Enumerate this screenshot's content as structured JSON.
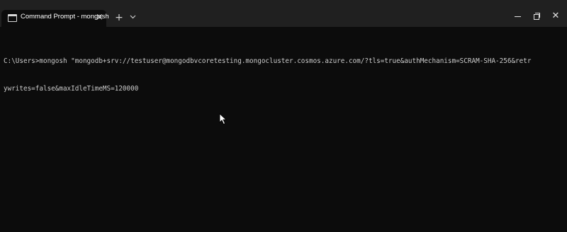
{
  "window": {
    "tab_title": "Command Prompt - mongosh",
    "tab_close": "×",
    "new_tab": "+",
    "tab_dropdown": "⌄",
    "close_symbol": "✕"
  },
  "terminal": {
    "line1": "C:\\Users>mongosh \"mongodb+srv://testuser@mongodbvcoretesting.mongocluster.cosmos.azure.com/?tls=true&authMechanism=SCRAM-SHA-256&retr",
    "line2": "ywrites=false&maxIdleTimeMS=120000"
  },
  "colors": {
    "background": "#0c0c0c",
    "titlebar": "#202020",
    "text": "#cccccc"
  }
}
